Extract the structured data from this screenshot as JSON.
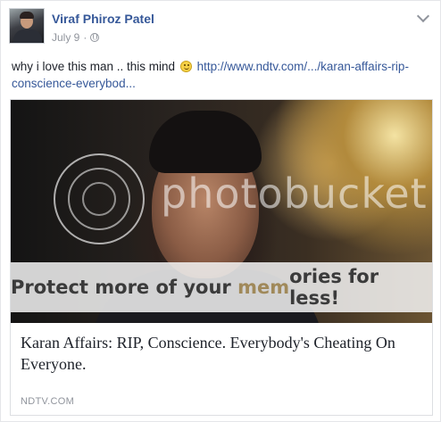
{
  "post": {
    "author": "Viraf Phiroz Patel",
    "date": "July 9",
    "separator": "·",
    "text_before": "why i love this man .. this mind",
    "link_text": "http://www.ndtv.com/.../karan-affairs-rip-conscience-everybod..."
  },
  "icons": {
    "privacy": "globe-icon",
    "menu": "chevron-down-icon",
    "emoji": "smiley-icon"
  },
  "card": {
    "watermark_brand": "photobucket",
    "banner_part1": "Protect more of your ",
    "banner_highlight": "mem",
    "banner_part2": "ories for less!",
    "title": "Karan Affairs: RIP, Conscience. Everybody's Cheating On Everyone.",
    "source": "NDTV.COM"
  },
  "colors": {
    "link": "#365899",
    "text": "#1d2129",
    "meta": "#90949c"
  }
}
